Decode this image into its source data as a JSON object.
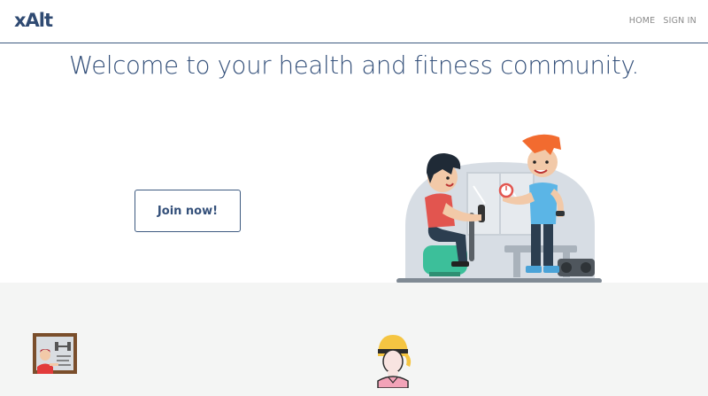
{
  "brand": {
    "logo": "xAlt"
  },
  "nav": {
    "home_label": "HOME",
    "signin_label": "SIGN IN"
  },
  "hero": {
    "title": "Welcome to your health and fitness community.",
    "cta_label": "Join now!"
  },
  "colors": {
    "accent": "#34507a",
    "features_bg": "#f4f5f4"
  },
  "icons": {
    "hero": "gym-trainer-illustration",
    "feature_1": "trainer-whiteboard-icon",
    "feature_2": "female-member-avatar-icon"
  }
}
